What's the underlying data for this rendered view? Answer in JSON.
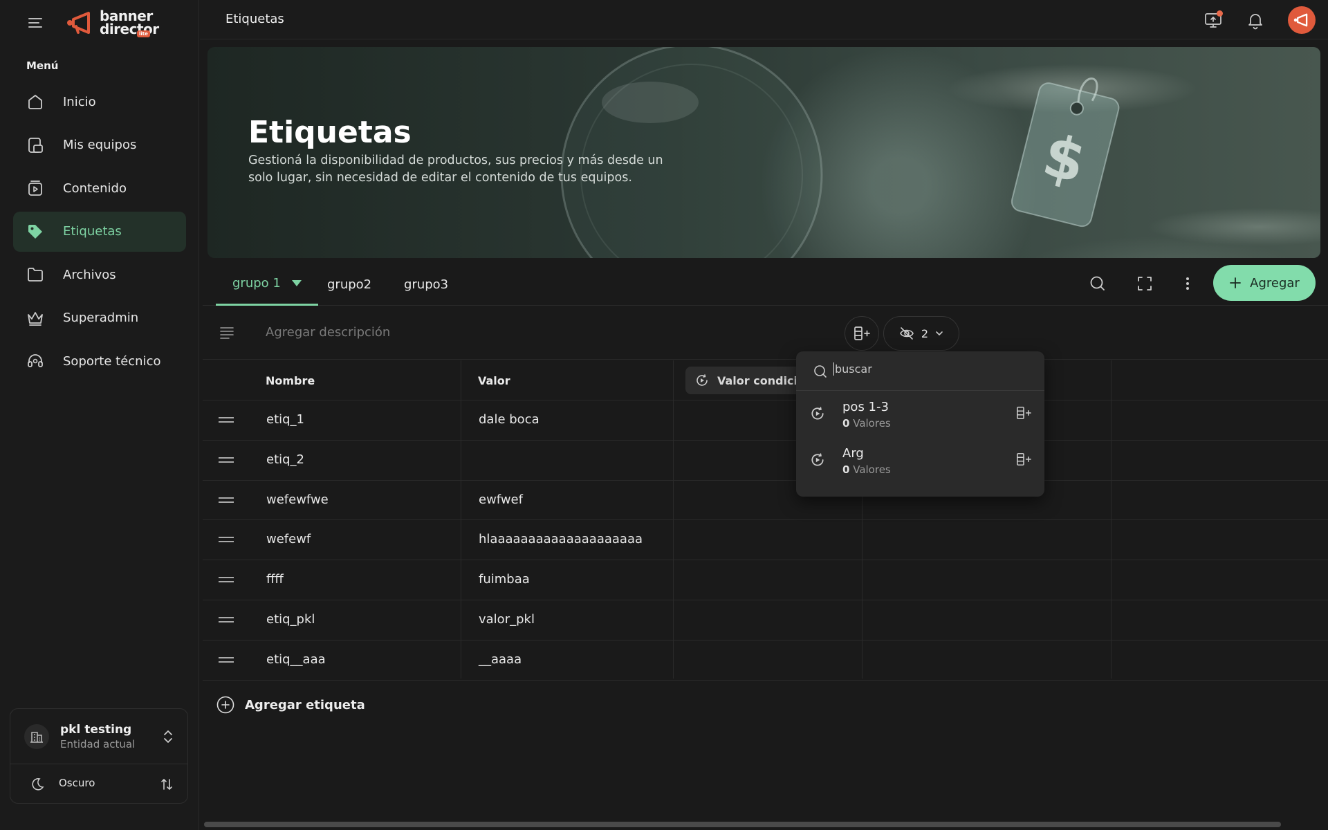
{
  "sidebar": {
    "logo_line1": "banner",
    "logo_line2": "director",
    "logo_badge": "lite",
    "menu_label": "Menú",
    "items": [
      {
        "label": "Inicio",
        "icon": "home-icon"
      },
      {
        "label": "Mis equipos",
        "icon": "devices-icon"
      },
      {
        "label": "Contenido",
        "icon": "content-icon"
      },
      {
        "label": "Etiquetas",
        "icon": "tag-icon",
        "active": true
      },
      {
        "label": "Archivos",
        "icon": "folder-icon"
      },
      {
        "label": "Superadmin",
        "icon": "crown-icon"
      },
      {
        "label": "Soporte técnico",
        "icon": "headset-icon"
      }
    ],
    "entity": {
      "name": "pkl testing",
      "subtitle": "Entidad actual"
    },
    "theme": {
      "label": "Oscuro"
    }
  },
  "topbar": {
    "title": "Etiquetas"
  },
  "banner": {
    "title": "Etiquetas",
    "description": "Gestioná la disponibilidad de productos, sus precios y más desde un solo lugar, sin necesidad de editar el contenido de tus equipos."
  },
  "tabs": [
    {
      "label": "grupo 1",
      "active": true
    },
    {
      "label": "grupo2"
    },
    {
      "label": "grupo3"
    }
  ],
  "toolbar": {
    "add_label": "Agregar",
    "hidden_count": "2"
  },
  "description_placeholder": "Agregar descripción",
  "table": {
    "columns": [
      "Nombre",
      "Valor",
      "Valor condici"
    ],
    "rows": [
      {
        "name": "etiq_1",
        "value": "dale boca"
      },
      {
        "name": "etiq_2",
        "value": ""
      },
      {
        "name": "wefewfwe",
        "value": "ewfwef"
      },
      {
        "name": "wefewf",
        "value": "hlaaaaaaaaaaaaaaaaaaaa"
      },
      {
        "name": "ffff",
        "value": "fuimbaa"
      },
      {
        "name": "etiq_pkl",
        "value": "valor_pkl"
      },
      {
        "name": "etiq__aaa",
        "value": "__aaaa"
      }
    ],
    "add_row_label": "Agregar etiqueta"
  },
  "popover": {
    "search_placeholder": "buscar",
    "items": [
      {
        "name": "pos 1-3",
        "count": "0",
        "count_label": "Valores"
      },
      {
        "name": "Arg",
        "count": "0",
        "count_label": "Valores"
      }
    ]
  },
  "colors": {
    "accent": "#82dcab",
    "active_nav_bg": "#233129",
    "brand": "#e05a3c",
    "background": "#1a1a1a"
  }
}
